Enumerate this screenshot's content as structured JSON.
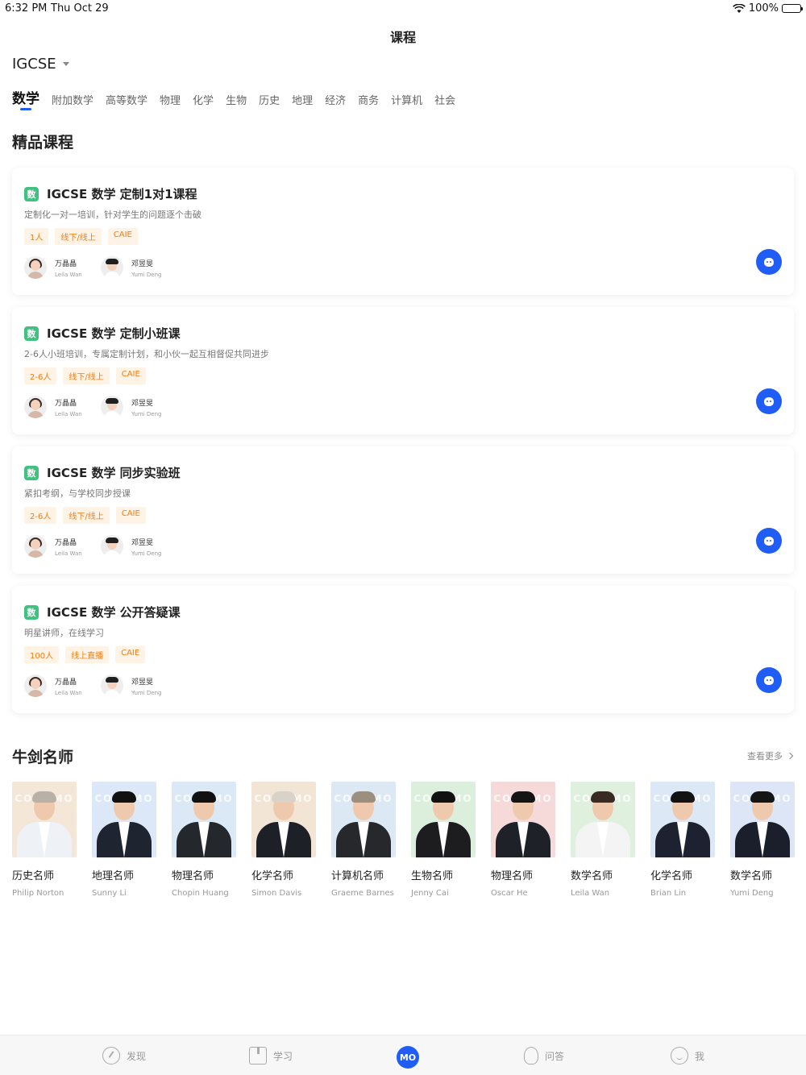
{
  "status_bar": {
    "time": "6:32 PM",
    "date": "Thu Oct 29",
    "battery": "100%"
  },
  "header": {
    "title": "课程"
  },
  "level": {
    "selected": "IGCSE"
  },
  "subjects": [
    "数学",
    "附加数学",
    "高等数学",
    "物理",
    "化学",
    "生物",
    "历史",
    "地理",
    "经济",
    "商务",
    "计算机",
    "社会"
  ],
  "featured": {
    "title": "精品课程",
    "courses": [
      {
        "chip": "数",
        "title": "IGCSE 数学 定制1对1课程",
        "desc": "定制化一对一培训，针对学生的问题逐个击破",
        "tags": [
          "1人",
          "线下/线上",
          "CAIE"
        ],
        "teachers": [
          {
            "name": "万晶晶",
            "en": "Leila Wan"
          },
          {
            "name": "邓昱旻",
            "en": "Yumi Deng"
          }
        ]
      },
      {
        "chip": "数",
        "title": "IGCSE 数学 定制小班课",
        "desc": "2-6人小班培训，专属定制计划，和小伙一起互相督促共同进步",
        "tags": [
          "2-6人",
          "线下/线上",
          "CAIE"
        ],
        "teachers": [
          {
            "name": "万晶晶",
            "en": "Leila Wan"
          },
          {
            "name": "邓昱旻",
            "en": "Yumi Deng"
          }
        ]
      },
      {
        "chip": "数",
        "title": "IGCSE 数学 同步实验班",
        "desc": "紧扣考纲，与学校同步授课",
        "tags": [
          "2-6人",
          "线下/线上",
          "CAIE"
        ],
        "teachers": [
          {
            "name": "万晶晶",
            "en": "Leila Wan"
          },
          {
            "name": "邓昱旻",
            "en": "Yumi Deng"
          }
        ]
      },
      {
        "chip": "数",
        "title": "IGCSE 数学 公开答疑课",
        "desc": "明星讲师，在线学习",
        "tags": [
          "100人",
          "线上直播",
          "CAIE"
        ],
        "teachers": [
          {
            "name": "万晶晶",
            "en": "Leila Wan"
          },
          {
            "name": "邓昱旻",
            "en": "Yumi Deng"
          }
        ]
      }
    ]
  },
  "teachers_section": {
    "title": "牛剑名师",
    "more": "查看更多",
    "watermark": "COMEMO",
    "list": [
      {
        "title": "历史名师",
        "name": "Philip Norton",
        "bg": "#f5e7d8",
        "hair": "#b9b1a8",
        "suit": "#eef2f7"
      },
      {
        "title": "地理名师",
        "name": "Sunny Li",
        "bg": "#dce8f7",
        "hair": "#111111",
        "suit": "#1e2430"
      },
      {
        "title": "物理名师",
        "name": "Chopin Huang",
        "bg": "#dbe9f6",
        "hair": "#111111",
        "suit": "#24272c"
      },
      {
        "title": "化学名师",
        "name": "Simon Davis",
        "bg": "#f3e5d5",
        "hair": "#d8d2c8",
        "suit": "#1e2028"
      },
      {
        "title": "计算机名师",
        "name": "Graeme Barnes",
        "bg": "#dce9f5",
        "hair": "#9c8f80",
        "suit": "#26282c"
      },
      {
        "title": "生物名师",
        "name": "Jenny Cai",
        "bg": "#dcefdc",
        "hair": "#111111",
        "suit": "#1d1d1f"
      },
      {
        "title": "物理名师",
        "name": "Oscar He",
        "bg": "#f6dada",
        "hair": "#141414",
        "suit": "#1f2128"
      },
      {
        "title": "数学名师",
        "name": "Leila Wan",
        "bg": "#dff0df",
        "hair": "#3a2a24",
        "suit": "#f4f4f4"
      },
      {
        "title": "化学名师",
        "name": "Brian Lin",
        "bg": "#dce8f6",
        "hair": "#121212",
        "suit": "#1e2230"
      },
      {
        "title": "数学名师",
        "name": "Yumi Deng",
        "bg": "#dde6f6",
        "hair": "#151515",
        "suit": "#1b1f2b"
      }
    ]
  },
  "tab_bar": {
    "items": [
      {
        "label": "发现",
        "icon": "compass-icon"
      },
      {
        "label": "学习",
        "icon": "book-icon"
      },
      {
        "label": "问答",
        "icon": "bulb-icon"
      },
      {
        "label": "我",
        "icon": "face-icon"
      }
    ],
    "center_logo": "MO"
  },
  "colors": {
    "accent": "#1f5df5",
    "tag_text": "#f07d16",
    "tag_bg": "#fff3e6",
    "chip": "#3fc280"
  }
}
